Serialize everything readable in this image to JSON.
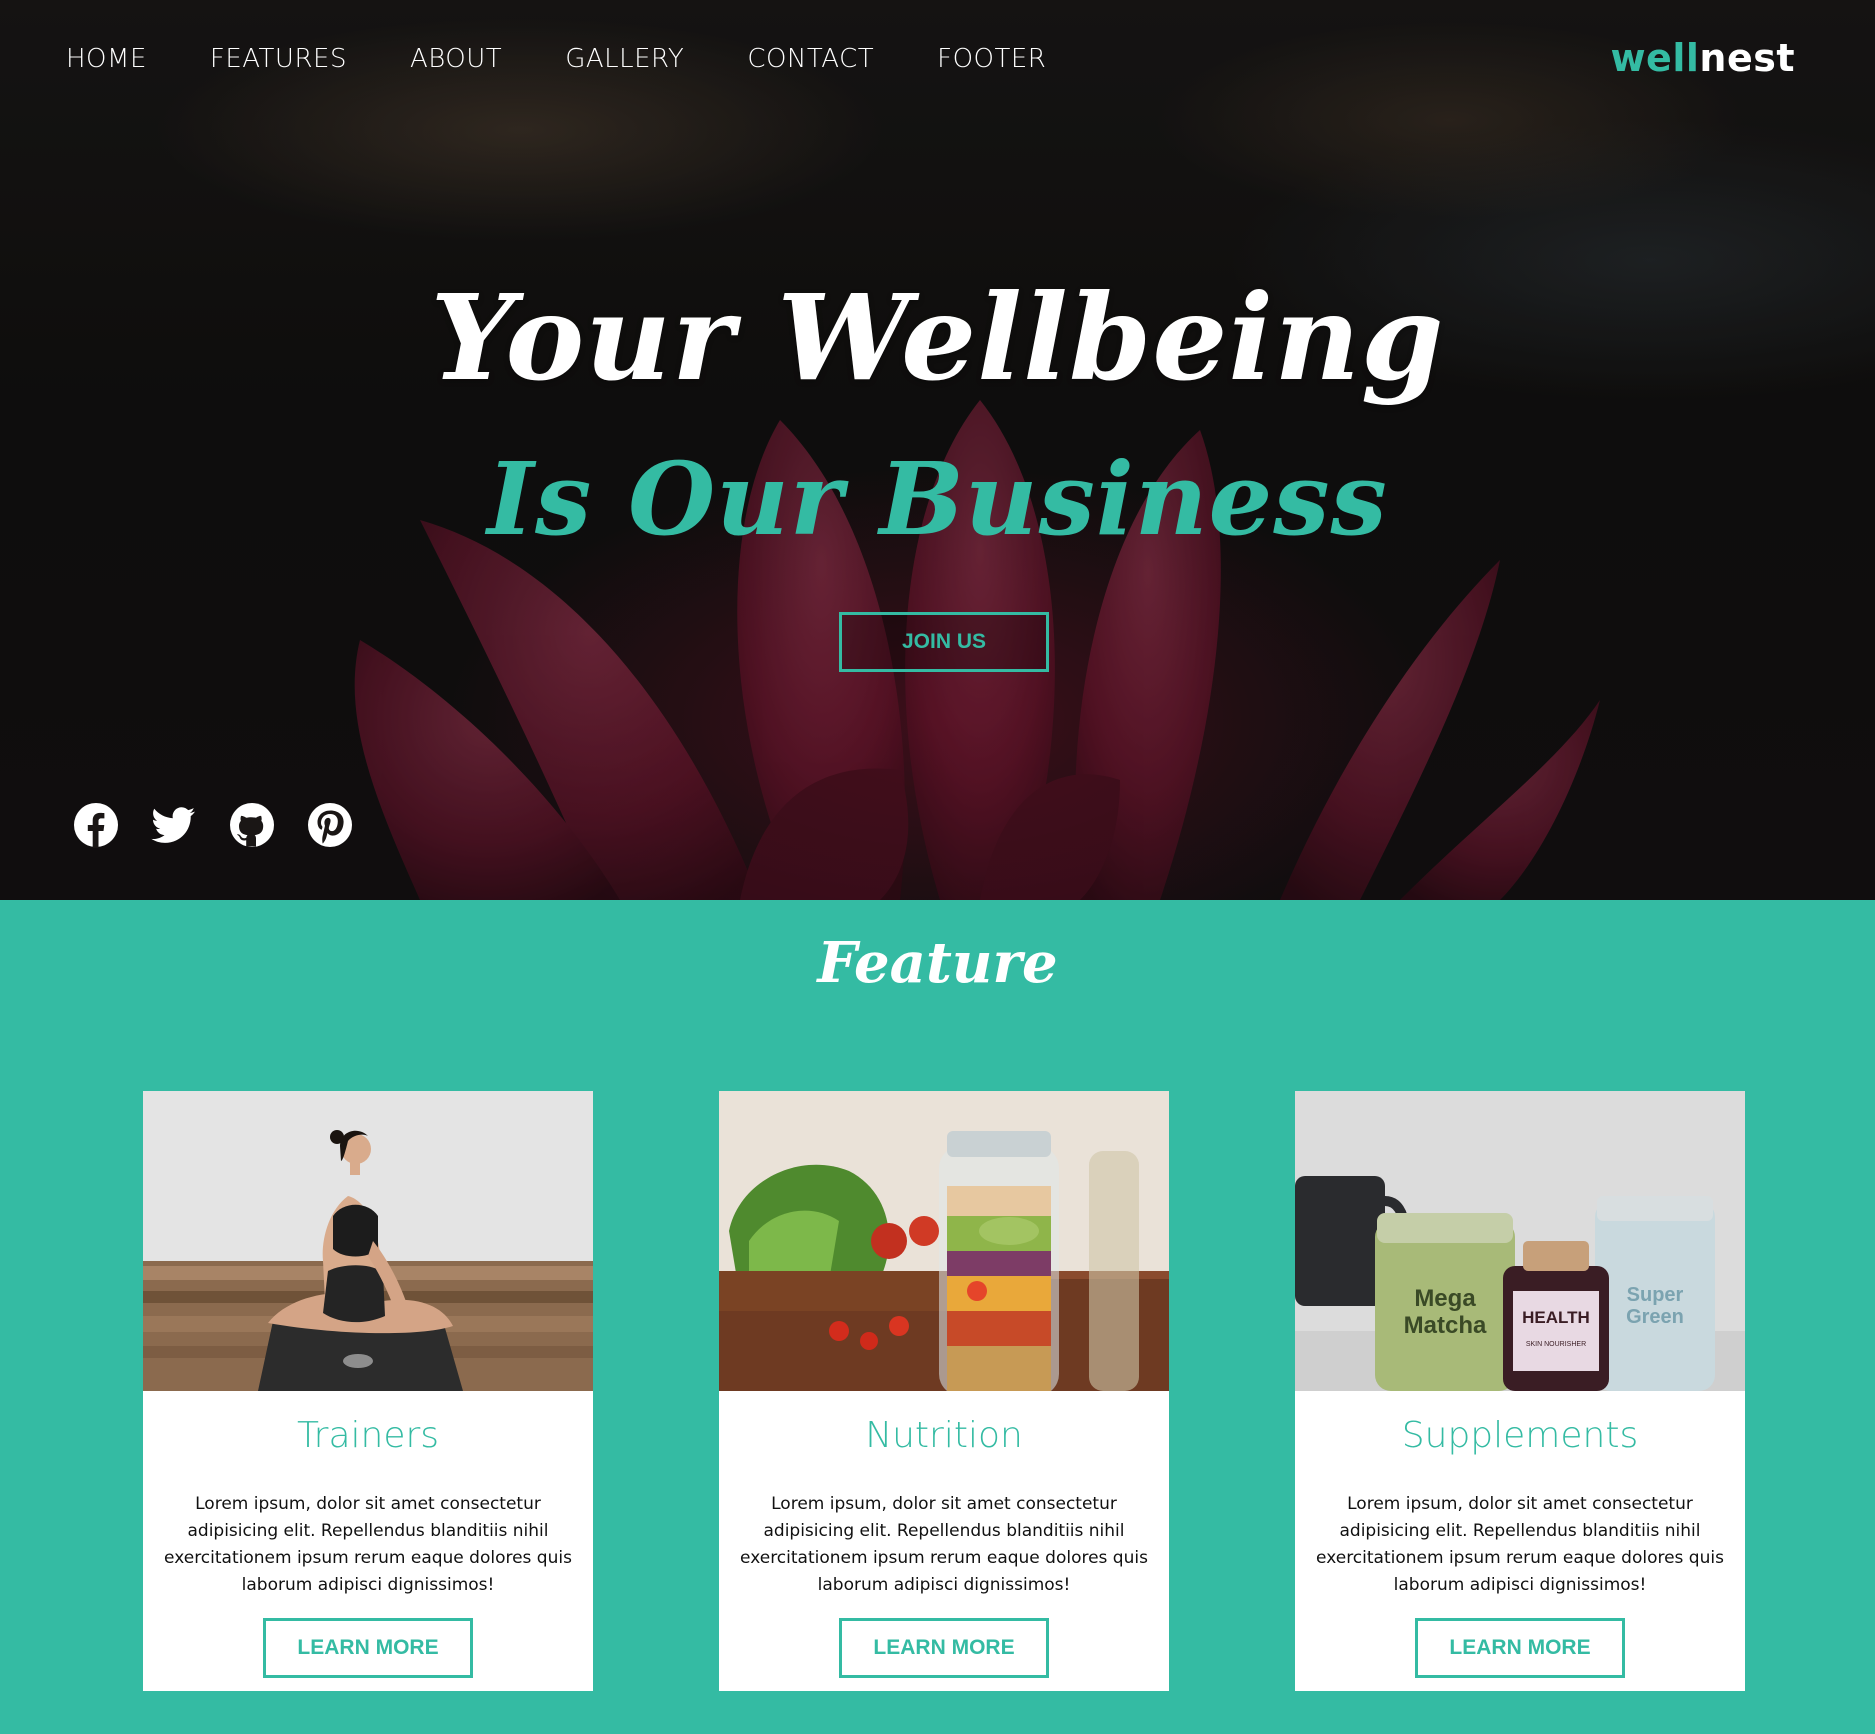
{
  "brand": {
    "part1": "well",
    "part2": "nest",
    "accent_color": "#34bba3"
  },
  "nav": {
    "items": [
      {
        "label": "HOME"
      },
      {
        "label": "FEATURES"
      },
      {
        "label": "ABOUT"
      },
      {
        "label": "GALLERY"
      },
      {
        "label": "CONTACT"
      },
      {
        "label": "FOOTER"
      }
    ]
  },
  "hero": {
    "headline_line1": "Your Wellbeing",
    "headline_line2": "Is Our Business",
    "cta_label": "JOIN US",
    "socials": [
      {
        "icon": "facebook-icon"
      },
      {
        "icon": "twitter-icon"
      },
      {
        "icon": "github-icon"
      },
      {
        "icon": "pinterest-icon"
      }
    ]
  },
  "feature": {
    "title": "Feature",
    "cards": [
      {
        "title": "Trainers",
        "text": "Lorem ipsum, dolor sit amet consectetur adipisicing elit. Repellendus blanditiis nihil exercitationem ipsum rerum eaque dolores quis laborum adipisci dignissimos!",
        "button": "LEARN MORE"
      },
      {
        "title": "Nutrition",
        "text": "Lorem ipsum, dolor sit amet consectetur adipisicing elit. Repellendus blanditiis nihil exercitationem ipsum rerum eaque dolores quis laborum adipisci dignissimos!",
        "button": "LEARN MORE"
      },
      {
        "title": "Supplements",
        "text": "Lorem ipsum, dolor sit amet consectetur adipisicing elit. Repellendus blanditiis nihil exercitationem ipsum rerum eaque dolores quis laborum adipisci dignissimos!",
        "button": "LEARN MORE"
      }
    ],
    "supplement_labels": {
      "matcha_l1": "Mega",
      "matcha_l2": "Matcha",
      "health": "HEALTH",
      "health_sub": "SKIN NOURISHER",
      "green_l1": "Super",
      "green_l2": "Green"
    }
  }
}
